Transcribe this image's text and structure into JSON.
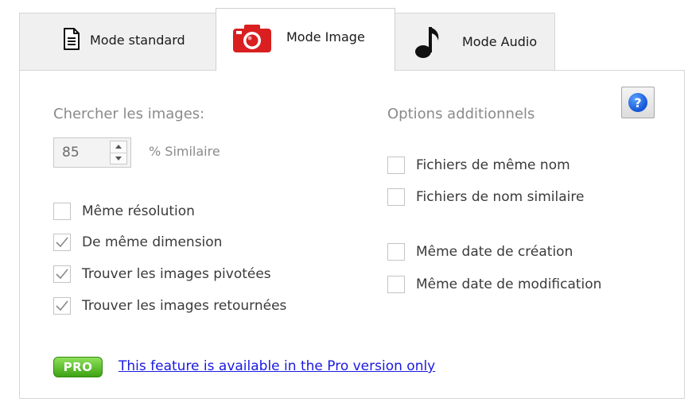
{
  "tabs": {
    "standard": {
      "label": "Mode standard",
      "icon": "document-icon"
    },
    "image": {
      "label": "Mode Image",
      "icon": "camera-icon"
    },
    "audio": {
      "label": "Mode Audio",
      "icon": "music-note-icon"
    },
    "active": "image"
  },
  "panel": {
    "help": {
      "icon": "help-icon",
      "glyph": "?"
    },
    "left": {
      "title": "Chercher les images:",
      "similarity": {
        "value": "85",
        "suffix": "% Similaire"
      },
      "options": [
        {
          "label": "Même résolution",
          "checked": false
        },
        {
          "label": "De même dimension",
          "checked": true
        },
        {
          "label": "Trouver les images pivotées",
          "checked": true
        },
        {
          "label": "Trouver les images retournées",
          "checked": true
        }
      ]
    },
    "right": {
      "title": "Options additionnels",
      "options": [
        {
          "label": "Fichiers de même nom",
          "checked": false
        },
        {
          "label": "Fichiers de nom similaire",
          "checked": false
        },
        {
          "label": "Même date de création",
          "checked": false
        },
        {
          "label": "Même date de modification",
          "checked": false
        }
      ]
    },
    "pro": {
      "badge": "PRO",
      "link_text": "This feature is available in the Pro version only"
    }
  },
  "colors": {
    "camera": "#d91f1f",
    "pro_badge": "#4cb51e",
    "link": "#1a1ae0",
    "help": "#1456d6"
  }
}
